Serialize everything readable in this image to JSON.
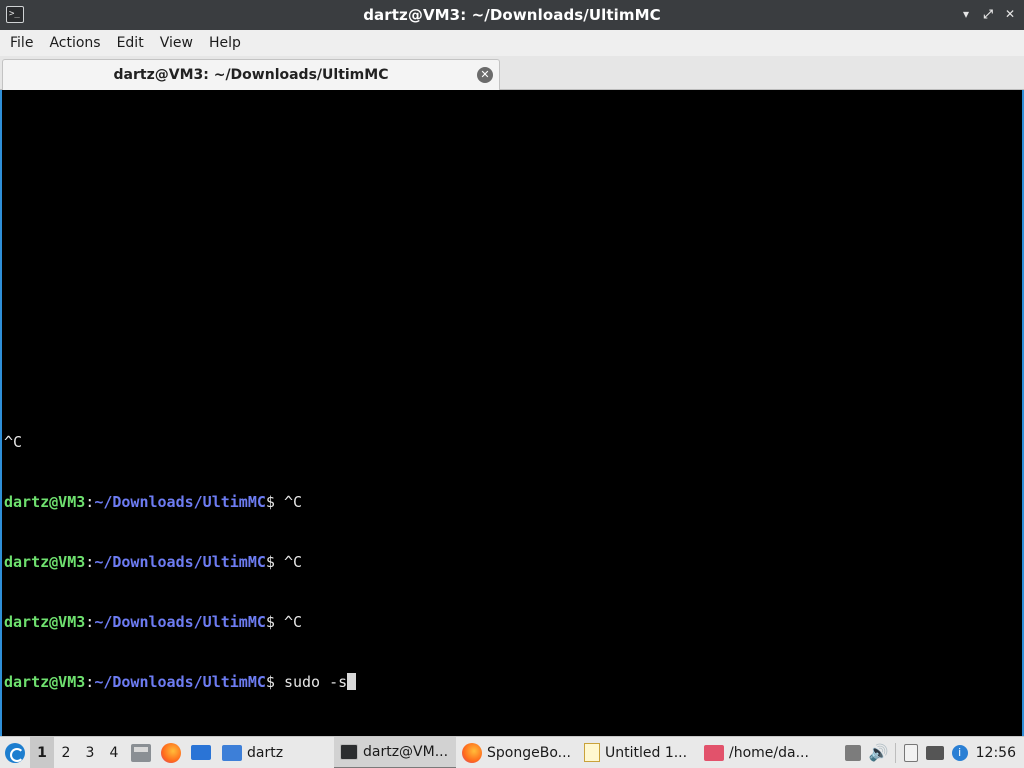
{
  "window": {
    "title": "dartz@VM3: ~/Downloads/UltimMC",
    "minimize_glyph": "▾",
    "maximize_glyph": "⤢",
    "close_glyph": "✕",
    "app_icon_text": ">_"
  },
  "menubar": {
    "items": [
      "File",
      "Actions",
      "Edit",
      "View",
      "Help"
    ]
  },
  "tabs": [
    {
      "label": "dartz@VM3: ~/Downloads/UltimMC",
      "close_glyph": "✕"
    }
  ],
  "terminal": {
    "lines": [
      {
        "plain": "^C"
      },
      {
        "user": "dartz@VM3",
        "sep": ":",
        "path": "~/Downloads/UltimMC",
        "prompt": "$ ",
        "cmd": "^C"
      },
      {
        "user": "dartz@VM3",
        "sep": ":",
        "path": "~/Downloads/UltimMC",
        "prompt": "$ ",
        "cmd": "^C"
      },
      {
        "user": "dartz@VM3",
        "sep": ":",
        "path": "~/Downloads/UltimMC",
        "prompt": "$ ",
        "cmd": "^C"
      },
      {
        "user": "dartz@VM3",
        "sep": ":",
        "path": "~/Downloads/UltimMC",
        "prompt": "$ ",
        "cmd": "sudo -s"
      }
    ]
  },
  "taskbar": {
    "desktops": [
      "1",
      "2",
      "3",
      "4"
    ],
    "active_desktop": "1",
    "quick_launch": [
      "files-icon",
      "firefox-icon",
      "show-desktop-icon"
    ],
    "tasks": [
      {
        "icon": "folder-icon",
        "label": "dartz"
      },
      {
        "icon": "terminal-icon",
        "label": "dartz@VM..."
      },
      {
        "icon": "firefox-icon",
        "label": "SpongeBo..."
      },
      {
        "icon": "text-editor-icon",
        "label": "Untitled 1..."
      },
      {
        "icon": "image-viewer-icon",
        "label": "/home/da..."
      }
    ],
    "clock": "12:56"
  }
}
